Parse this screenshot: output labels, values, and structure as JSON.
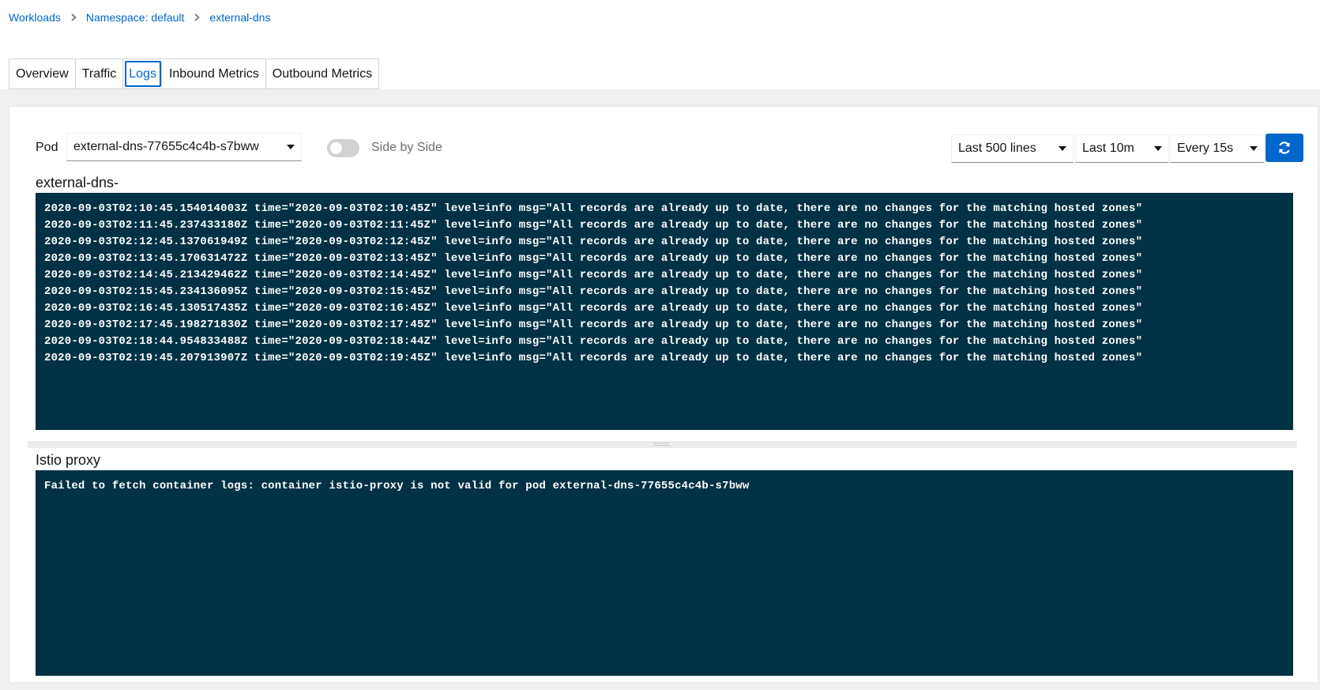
{
  "breadcrumb": {
    "items": [
      "Workloads",
      "Namespace: default",
      "external-dns"
    ]
  },
  "tabs": [
    "Overview",
    "Traffic",
    "Logs",
    "Inbound Metrics",
    "Outbound Metrics"
  ],
  "active_tab": "Logs",
  "toolbar": {
    "pod_label": "Pod",
    "pod_value": "external-dns-77655c4c4b-s7bww",
    "side_by_side_label": "Side by Side",
    "side_by_side_on": false,
    "lines_value": "Last 500 lines",
    "range_value": "Last 10m",
    "interval_value": "Every 15s",
    "refresh_icon": "refresh-icon"
  },
  "containers": [
    {
      "title": "external-dns-",
      "lines": [
        "2020-09-03T02:10:45.154014003Z time=\"2020-09-03T02:10:45Z\" level=info msg=\"All records are already up to date, there are no changes for the matching hosted zones\"",
        "2020-09-03T02:11:45.237433180Z time=\"2020-09-03T02:11:45Z\" level=info msg=\"All records are already up to date, there are no changes for the matching hosted zones\"",
        "2020-09-03T02:12:45.137061949Z time=\"2020-09-03T02:12:45Z\" level=info msg=\"All records are already up to date, there are no changes for the matching hosted zones\"",
        "2020-09-03T02:13:45.170631472Z time=\"2020-09-03T02:13:45Z\" level=info msg=\"All records are already up to date, there are no changes for the matching hosted zones\"",
        "2020-09-03T02:14:45.213429462Z time=\"2020-09-03T02:14:45Z\" level=info msg=\"All records are already up to date, there are no changes for the matching hosted zones\"",
        "2020-09-03T02:15:45.234136095Z time=\"2020-09-03T02:15:45Z\" level=info msg=\"All records are already up to date, there are no changes for the matching hosted zones\"",
        "2020-09-03T02:16:45.130517435Z time=\"2020-09-03T02:16:45Z\" level=info msg=\"All records are already up to date, there are no changes for the matching hosted zones\"",
        "2020-09-03T02:17:45.198271830Z time=\"2020-09-03T02:17:45Z\" level=info msg=\"All records are already up to date, there are no changes for the matching hosted zones\"",
        "2020-09-03T02:18:44.954833488Z time=\"2020-09-03T02:18:44Z\" level=info msg=\"All records are already up to date, there are no changes for the matching hosted zones\"",
        "2020-09-03T02:19:45.207913907Z time=\"2020-09-03T02:19:45Z\" level=info msg=\"All records are already up to date, there are no changes for the matching hosted zones\""
      ]
    },
    {
      "title": "Istio proxy",
      "lines": [
        "Failed to fetch container logs: container istio-proxy is not valid for pod external-dns-77655c4c4b-s7bww"
      ]
    }
  ],
  "colors": {
    "link": "#0066cc",
    "log_background": "#003145",
    "refresh_button": "#0066cc"
  }
}
